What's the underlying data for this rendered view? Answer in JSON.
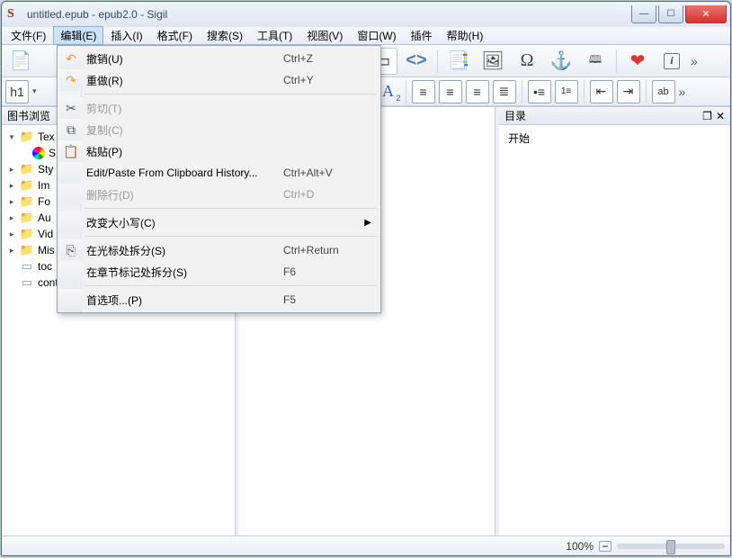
{
  "titlebar": {
    "text": "untitled.epub - epub2.0 - Sigil",
    "app_letter": "S"
  },
  "menus": [
    "文件(F)",
    "编辑(E)",
    "插入(I)",
    "格式(F)",
    "搜索(S)",
    "工具(T)",
    "视图(V)",
    "窗口(W)",
    "插件",
    "帮助(H)"
  ],
  "open_menu_index": 1,
  "dropdown": [
    {
      "type": "item",
      "icon": "undo-icon",
      "label": "撤销(U)",
      "accel": "Ctrl+Z"
    },
    {
      "type": "item",
      "icon": "redo-icon",
      "label": "重做(R)",
      "accel": "Ctrl+Y"
    },
    {
      "type": "sep"
    },
    {
      "type": "item",
      "icon": "cut-icon",
      "label": "剪切(T)",
      "accel": "",
      "disabled": true
    },
    {
      "type": "item",
      "icon": "copy-icon",
      "label": "复制(C)",
      "accel": "",
      "disabled": true
    },
    {
      "type": "item",
      "icon": "paste-icon",
      "label": "粘贴(P)",
      "accel": ""
    },
    {
      "type": "item",
      "label": "Edit/Paste From Clipboard History...",
      "accel": "Ctrl+Alt+V"
    },
    {
      "type": "item",
      "label": "删除行(D)",
      "accel": "Ctrl+D",
      "disabled": true
    },
    {
      "type": "sep"
    },
    {
      "type": "item",
      "label": "改变大小写(C)",
      "submenu": true
    },
    {
      "type": "sep"
    },
    {
      "type": "item",
      "icon": "split-icon",
      "label": "在光标处拆分(S)",
      "accel": "Ctrl+Return"
    },
    {
      "type": "item",
      "label": "在章节标记处拆分(S)",
      "accel": "F6"
    },
    {
      "type": "sep"
    },
    {
      "type": "item",
      "label": "首选项...(P)",
      "accel": "F5"
    }
  ],
  "toolbar1_right": [
    "angle-brackets-icon",
    "book-icon",
    "image-icon",
    "omega-icon",
    "anchor-icon",
    "id-icon",
    "sep",
    "heart-icon",
    "info-icon"
  ],
  "toolbar2": {
    "h_label": "h1",
    "right_buttons": [
      "align-left-icon",
      "align-center-icon",
      "align-right-icon",
      "align-justify-icon",
      "sep",
      "list-bullet-icon",
      "list-number-icon",
      "sep",
      "indent-left-icon",
      "indent-right-icon",
      "sep",
      "ab-icon"
    ],
    "super_label": "A",
    "sub_label": "A"
  },
  "left_pane": {
    "title": "图书浏览",
    "tree": [
      {
        "depth": 0,
        "kind": "folder",
        "label": "Tex",
        "tw": "▾"
      },
      {
        "depth": 1,
        "kind": "color",
        "label": "S"
      },
      {
        "depth": 0,
        "kind": "folder",
        "label": "Sty"
      },
      {
        "depth": 0,
        "kind": "folder",
        "label": "Im"
      },
      {
        "depth": 0,
        "kind": "folder",
        "label": "Fo"
      },
      {
        "depth": 0,
        "kind": "folder",
        "label": "Au"
      },
      {
        "depth": 0,
        "kind": "folder",
        "label": "Vid"
      },
      {
        "depth": 0,
        "kind": "folder",
        "label": "Mis"
      },
      {
        "depth": 0,
        "kind": "file",
        "label": "toc"
      },
      {
        "depth": 0,
        "kind": "file",
        "label": "content.opf"
      }
    ]
  },
  "right_pane": {
    "title": "目录",
    "item": "开始"
  },
  "status": {
    "zoom": "100%"
  }
}
